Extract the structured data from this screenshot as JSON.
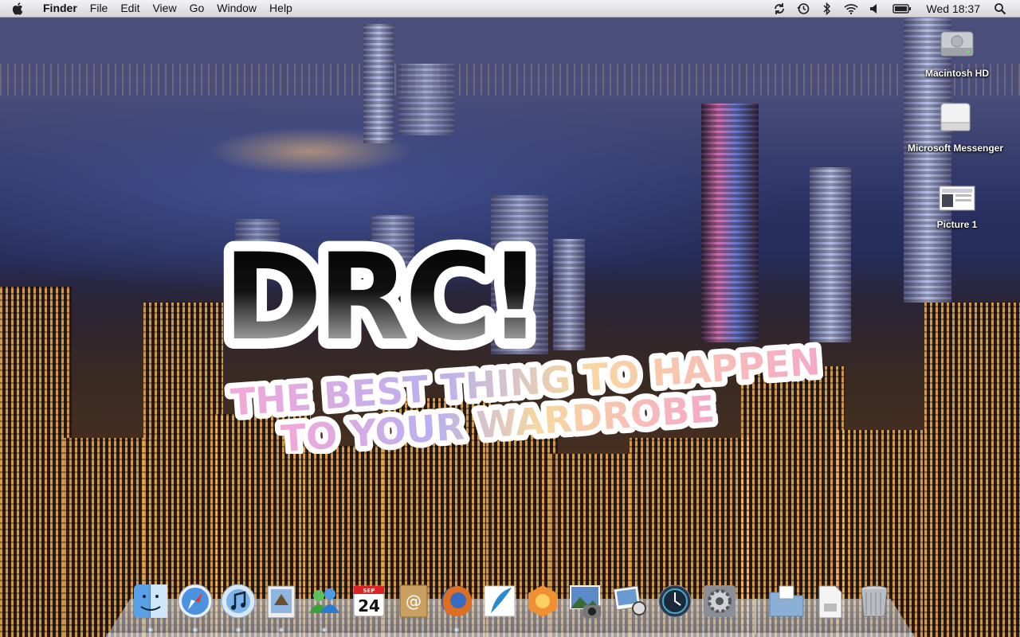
{
  "menubar": {
    "app_name": "Finder",
    "menus": [
      "File",
      "Edit",
      "View",
      "Go",
      "Window",
      "Help"
    ],
    "status_icons": [
      "sync-icon",
      "time-machine-icon",
      "bluetooth-icon",
      "wifi-icon",
      "volume-icon",
      "battery-icon"
    ],
    "clock": "Wed 18:37",
    "spotlight_icon": "spotlight-search-icon"
  },
  "desktop_icons": [
    {
      "label": "Macintosh HD",
      "icon": "hard-drive-icon"
    },
    {
      "label": "Microsoft Messenger",
      "icon": "disk-image-icon"
    },
    {
      "label": "Picture 1",
      "icon": "screenshot-file-icon"
    }
  ],
  "wallpaper": {
    "logo_text": "DRC!",
    "tagline_line1": "THE BEST THING TO HAPPEN",
    "tagline_line2": "TO YOUR WARDROBE"
  },
  "dock": {
    "apps": [
      {
        "name": "Finder",
        "icon": "finder-icon",
        "running": true
      },
      {
        "name": "Safari",
        "icon": "safari-icon",
        "running": true
      },
      {
        "name": "iTunes",
        "icon": "itunes-icon",
        "running": true
      },
      {
        "name": "Mail",
        "icon": "mail-icon",
        "running": true
      },
      {
        "name": "Messenger",
        "icon": "messenger-icon",
        "running": true
      },
      {
        "name": "iCal",
        "icon": "ical-icon",
        "running": false,
        "date_label": "24",
        "month_label": "SEP"
      },
      {
        "name": "Address Book",
        "icon": "address-book-icon",
        "running": false
      },
      {
        "name": "Firefox",
        "icon": "firefox-icon",
        "running": true
      },
      {
        "name": "Quill",
        "icon": "feather-icon",
        "running": false
      },
      {
        "name": "Aperture",
        "icon": "aperture-icon",
        "running": false
      },
      {
        "name": "iPhoto",
        "icon": "iphoto-icon",
        "running": false
      },
      {
        "name": "Preview",
        "icon": "preview-icon",
        "running": false
      },
      {
        "name": "Time Machine",
        "icon": "time-machine-icon",
        "running": false
      },
      {
        "name": "System Preferences",
        "icon": "system-preferences-icon",
        "running": false
      }
    ],
    "stacks": [
      {
        "name": "Documents",
        "icon": "folder-icon"
      },
      {
        "name": "Downloads",
        "icon": "document-icon"
      },
      {
        "name": "Trash",
        "icon": "trash-icon"
      }
    ]
  }
}
